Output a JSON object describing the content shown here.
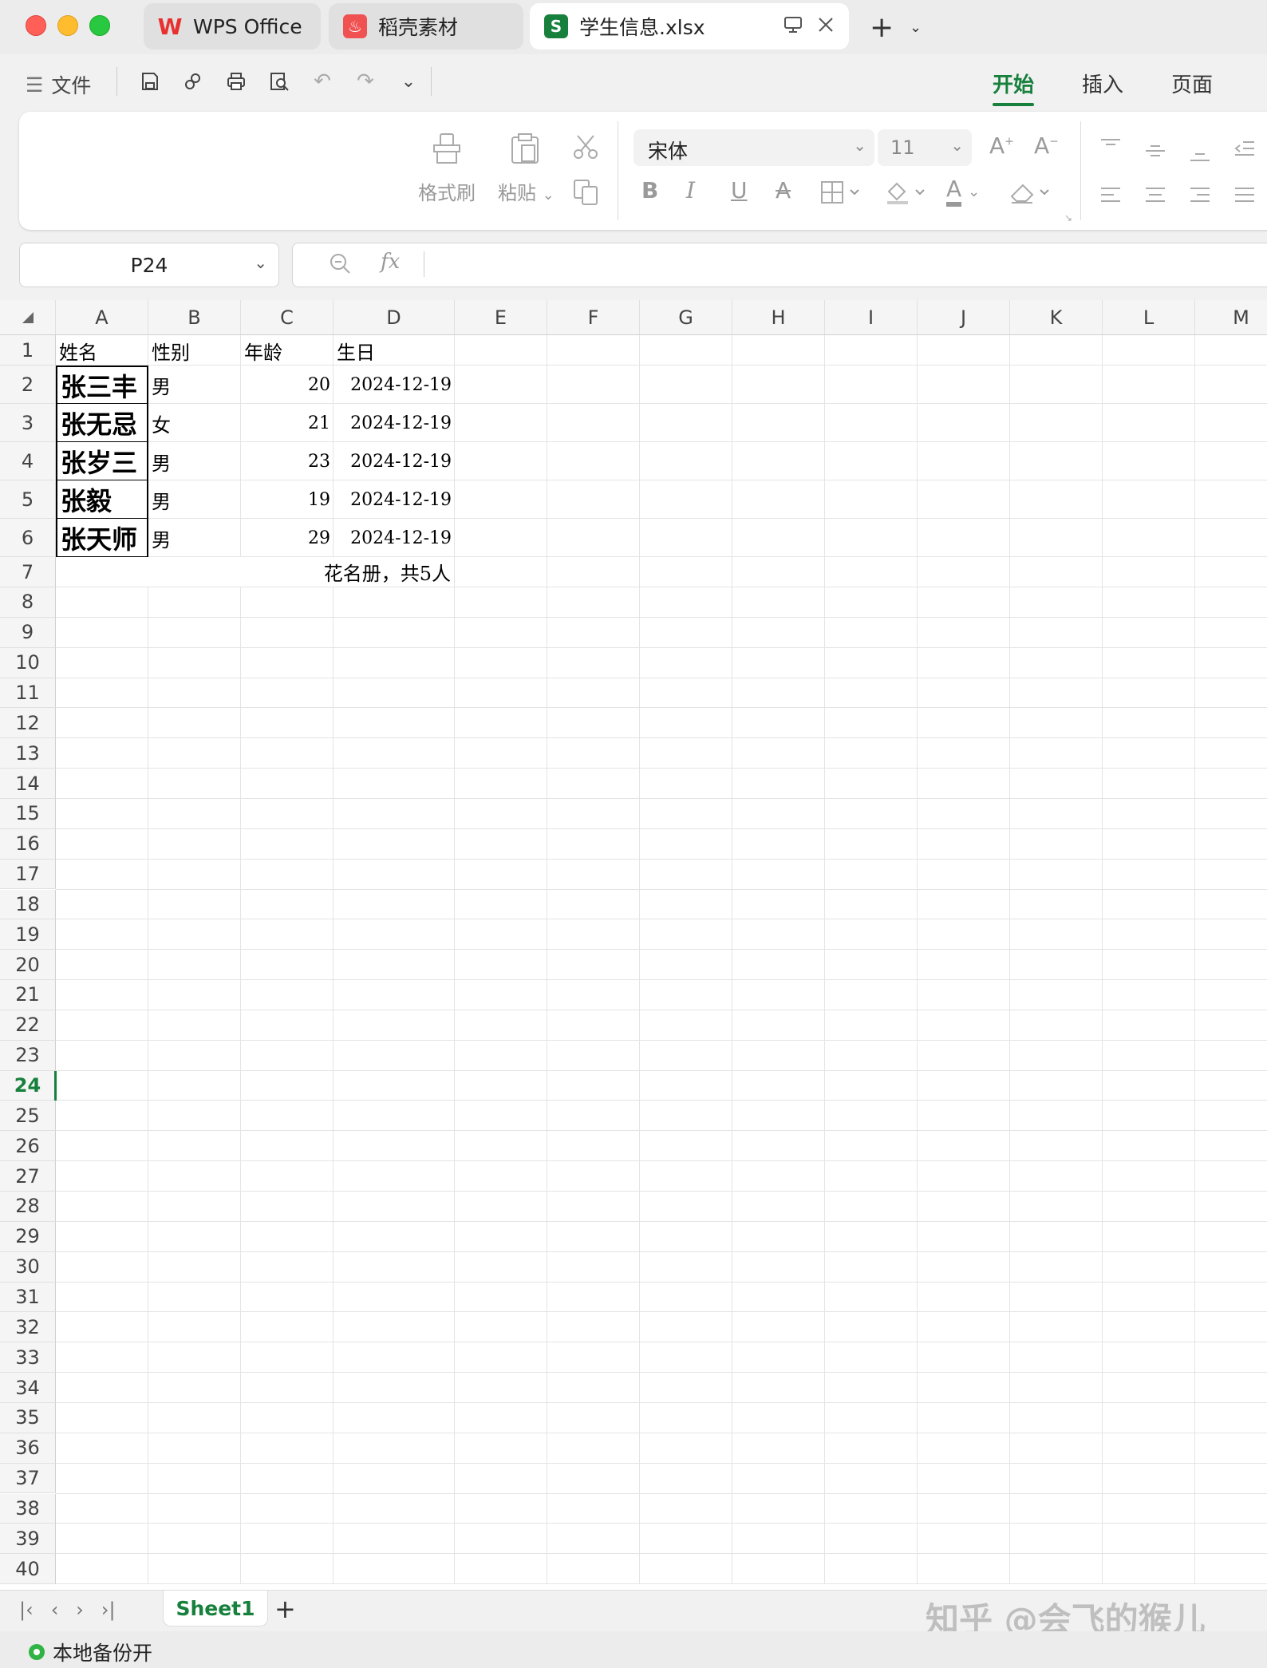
{
  "tabs": [
    {
      "label": "WPS Office",
      "icon": "wps-logo-icon",
      "color": "#e8312f"
    },
    {
      "label": "稻壳素材",
      "icon": "docer-logo-icon",
      "color": "#f05151"
    },
    {
      "label": "学生信息.xlsx",
      "icon": "spreadsheet-s-icon",
      "icon_text": "S",
      "color": "#17803d"
    }
  ],
  "menu": {
    "file": "文件"
  },
  "ribbon_tabs": [
    {
      "label": "开始",
      "active": true
    },
    {
      "label": "插入",
      "active": false
    },
    {
      "label": "页面",
      "active": false
    }
  ],
  "ribbon": {
    "format_painter": "格式刷",
    "paste": "粘贴",
    "font_name": "宋体",
    "font_size": "11",
    "bold": "B",
    "italic": "I",
    "underline": "U",
    "strikethrough": "A",
    "font_color_letter": "A"
  },
  "formula": {
    "cell_ref": "P24",
    "fx": "fx",
    "value": ""
  },
  "columns": [
    "A",
    "B",
    "C",
    "D",
    "E",
    "F",
    "G",
    "H",
    "I",
    "J",
    "K",
    "L",
    "M"
  ],
  "rows": [
    "1",
    "2",
    "3",
    "4",
    "5",
    "6",
    "7",
    "8",
    "9",
    "10",
    "11",
    "12",
    "13",
    "14",
    "15",
    "16",
    "17",
    "18",
    "19",
    "20",
    "21",
    "22",
    "23",
    "24",
    "25",
    "26",
    "27",
    "28",
    "29",
    "30",
    "31",
    "32",
    "33",
    "34",
    "35",
    "36",
    "37",
    "38",
    "39",
    "40"
  ],
  "active_row": "24",
  "table": {
    "headers": [
      "姓名",
      "性别",
      "年龄",
      "生日"
    ],
    "rows": [
      [
        "张三丰",
        "男",
        "20",
        "2024-12-19"
      ],
      [
        "张无忌",
        "女",
        "21",
        "2024-12-19"
      ],
      [
        "张岁三",
        "男",
        "23",
        "2024-12-19"
      ],
      [
        "张毅",
        "男",
        "19",
        "2024-12-19"
      ],
      [
        "张天师",
        "男",
        "29",
        "2024-12-19"
      ]
    ],
    "footer": "花名册，共5人"
  },
  "sheets": [
    {
      "label": "Sheet1",
      "active": true
    }
  ],
  "status": {
    "backup": "本地备份开"
  },
  "watermark": "知乎 @会飞的猴儿",
  "colors": {
    "accent": "#17803d",
    "wps_red": "#e8312f"
  }
}
